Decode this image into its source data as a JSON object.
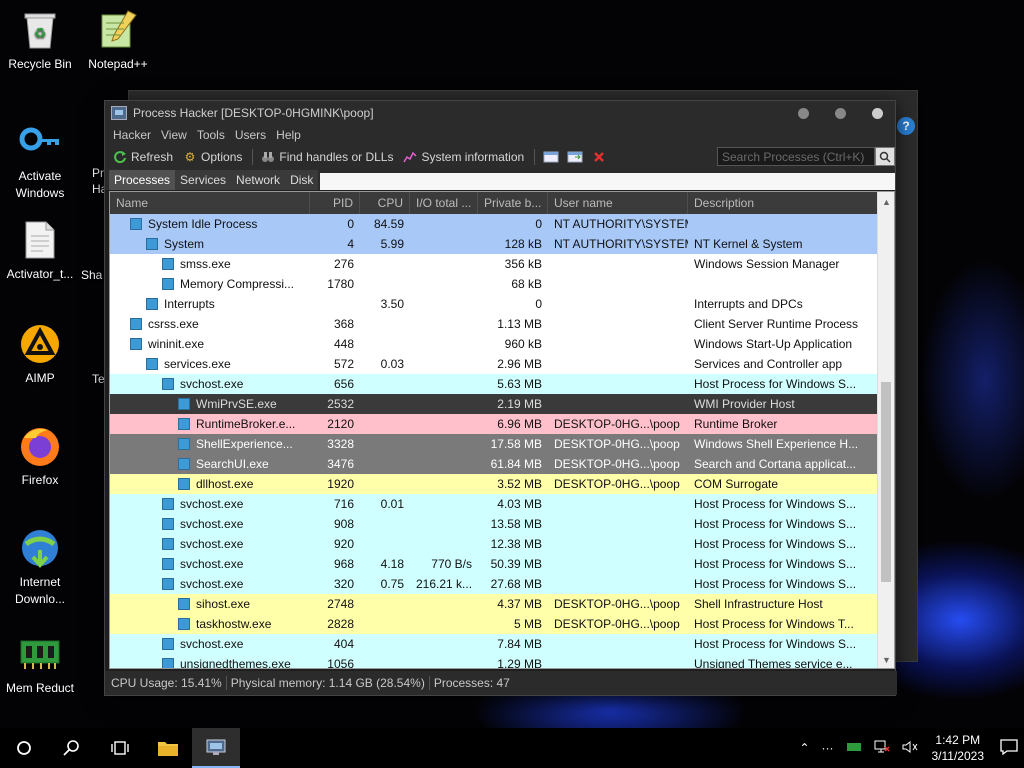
{
  "desktop": {
    "icons": [
      {
        "label": "Recycle Bin",
        "icon": "recycle-bin-icon"
      },
      {
        "label": "Notepad++",
        "icon": "notepadpp-icon"
      },
      {
        "label": "Activate Windows",
        "icon": "key-icon"
      },
      {
        "label": "Activator_t...",
        "icon": "document-icon"
      },
      {
        "label": "AIMP",
        "icon": "aimp-icon"
      },
      {
        "label": "Firefox",
        "icon": "firefox-icon"
      },
      {
        "label": "Internet Downlo...",
        "icon": "idm-icon"
      },
      {
        "label": "Mem Reduct",
        "icon": "memreduct-icon"
      }
    ],
    "partial_labels": [
      "Pr",
      "Ha",
      "Sha",
      "Te"
    ]
  },
  "window": {
    "title": "Process Hacker [DESKTOP-0HGMINK\\poop]",
    "menu": [
      "Hacker",
      "View",
      "Tools",
      "Users",
      "Help"
    ],
    "toolbar": {
      "refresh": "Refresh",
      "options": "Options",
      "find_handles": "Find handles or DLLs",
      "system_info": "System information"
    },
    "search_placeholder": "Search Processes (Ctrl+K)",
    "tabs": [
      "Processes",
      "Services",
      "Network",
      "Disk"
    ],
    "active_tab": "Processes",
    "columns": [
      "Name",
      "PID",
      "CPU",
      "I/O total ...",
      "Private b...",
      "User name",
      "Description"
    ],
    "rows": [
      {
        "name": "System Idle Process",
        "pid": "0",
        "cpu": "84.59",
        "io": "",
        "priv": "0",
        "user": "NT AUTHORITY\\SYSTEM",
        "desc": "",
        "color": "blue",
        "indent": 0,
        "twisty": true
      },
      {
        "name": "System",
        "pid": "4",
        "cpu": "5.99",
        "io": "",
        "priv": "128 kB",
        "user": "NT AUTHORITY\\SYSTEM",
        "desc": "NT Kernel & System",
        "color": "blue",
        "indent": 1,
        "twisty": true
      },
      {
        "name": "smss.exe",
        "pid": "276",
        "cpu": "",
        "io": "",
        "priv": "356 kB",
        "user": "",
        "desc": "Windows Session Manager",
        "color": "white",
        "indent": 2,
        "twisty": false
      },
      {
        "name": "Memory Compressi...",
        "pid": "1780",
        "cpu": "",
        "io": "",
        "priv": "68 kB",
        "user": "",
        "desc": "",
        "color": "white",
        "indent": 2,
        "twisty": false
      },
      {
        "name": "Interrupts",
        "pid": "",
        "cpu": "3.50",
        "io": "",
        "priv": "0",
        "user": "",
        "desc": "Interrupts and DPCs",
        "color": "white",
        "indent": 1,
        "twisty": false
      },
      {
        "name": "csrss.exe",
        "pid": "368",
        "cpu": "",
        "io": "",
        "priv": "1.13 MB",
        "user": "",
        "desc": "Client Server Runtime Process",
        "color": "white",
        "indent": 0,
        "twisty": false
      },
      {
        "name": "wininit.exe",
        "pid": "448",
        "cpu": "",
        "io": "",
        "priv": "960 kB",
        "user": "",
        "desc": "Windows Start-Up Application",
        "color": "white",
        "indent": 0,
        "twisty": true
      },
      {
        "name": "services.exe",
        "pid": "572",
        "cpu": "0.03",
        "io": "",
        "priv": "2.96 MB",
        "user": "",
        "desc": "Services and Controller app",
        "color": "white",
        "indent": 1,
        "twisty": true
      },
      {
        "name": "svchost.exe",
        "pid": "656",
        "cpu": "",
        "io": "",
        "priv": "5.63 MB",
        "user": "",
        "desc": "Host Process for Windows S...",
        "color": "cyan",
        "indent": 2,
        "twisty": true
      },
      {
        "name": "WmiPrvSE.exe",
        "pid": "2532",
        "cpu": "",
        "io": "",
        "priv": "2.19 MB",
        "user": "",
        "desc": "WMI Provider Host",
        "color": "dark",
        "indent": 3,
        "twisty": false
      },
      {
        "name": "RuntimeBroker.e...",
        "pid": "2120",
        "cpu": "",
        "io": "",
        "priv": "6.96 MB",
        "user": "DESKTOP-0HG...\\poop",
        "desc": "Runtime Broker",
        "color": "pink",
        "indent": 3,
        "twisty": false
      },
      {
        "name": "ShellExperience...",
        "pid": "3328",
        "cpu": "",
        "io": "",
        "priv": "17.58 MB",
        "user": "DESKTOP-0HG...\\poop",
        "desc": "Windows Shell Experience H...",
        "color": "gray",
        "indent": 3,
        "twisty": false
      },
      {
        "name": "SearchUI.exe",
        "pid": "3476",
        "cpu": "",
        "io": "",
        "priv": "61.84 MB",
        "user": "DESKTOP-0HG...\\poop",
        "desc": "Search and Cortana applicat...",
        "color": "gray",
        "indent": 3,
        "twisty": false
      },
      {
        "name": "dllhost.exe",
        "pid": "1920",
        "cpu": "",
        "io": "",
        "priv": "3.52 MB",
        "user": "DESKTOP-0HG...\\poop",
        "desc": "COM Surrogate",
        "color": "yellow",
        "indent": 3,
        "twisty": false
      },
      {
        "name": "svchost.exe",
        "pid": "716",
        "cpu": "0.01",
        "io": "",
        "priv": "4.03 MB",
        "user": "",
        "desc": "Host Process for Windows S...",
        "color": "cyan",
        "indent": 2,
        "twisty": false
      },
      {
        "name": "svchost.exe",
        "pid": "908",
        "cpu": "",
        "io": "",
        "priv": "13.58 MB",
        "user": "",
        "desc": "Host Process for Windows S...",
        "color": "cyan",
        "indent": 2,
        "twisty": false
      },
      {
        "name": "svchost.exe",
        "pid": "920",
        "cpu": "",
        "io": "",
        "priv": "12.38 MB",
        "user": "",
        "desc": "Host Process for Windows S...",
        "color": "cyan",
        "indent": 2,
        "twisty": false
      },
      {
        "name": "svchost.exe",
        "pid": "968",
        "cpu": "4.18",
        "io": "770 B/s",
        "priv": "50.39 MB",
        "user": "",
        "desc": "Host Process for Windows S...",
        "color": "cyan",
        "indent": 2,
        "twisty": false
      },
      {
        "name": "svchost.exe",
        "pid": "320",
        "cpu": "0.75",
        "io": "216.21 k...",
        "priv": "27.68 MB",
        "user": "",
        "desc": "Host Process for Windows S...",
        "color": "cyan",
        "indent": 2,
        "twisty": true
      },
      {
        "name": "sihost.exe",
        "pid": "2748",
        "cpu": "",
        "io": "",
        "priv": "4.37 MB",
        "user": "DESKTOP-0HG...\\poop",
        "desc": "Shell Infrastructure Host",
        "color": "yellow",
        "indent": 3,
        "twisty": false
      },
      {
        "name": "taskhostw.exe",
        "pid": "2828",
        "cpu": "",
        "io": "",
        "priv": "5 MB",
        "user": "DESKTOP-0HG...\\poop",
        "desc": "Host Process for Windows T...",
        "color": "yellow",
        "indent": 3,
        "twisty": false
      },
      {
        "name": "svchost.exe",
        "pid": "404",
        "cpu": "",
        "io": "",
        "priv": "7.84 MB",
        "user": "",
        "desc": "Host Process for Windows S...",
        "color": "cyan",
        "indent": 2,
        "twisty": false
      },
      {
        "name": "unsignedthemes.exe",
        "pid": "1056",
        "cpu": "",
        "io": "",
        "priv": "1.29 MB",
        "user": "",
        "desc": "Unsigned Themes service e...",
        "color": "cyan",
        "indent": 2,
        "twisty": false
      }
    ],
    "status": {
      "cpu": "CPU Usage: 15.41%",
      "memory": "Physical memory: 1.14 GB (28.54%)",
      "processes": "Processes: 47"
    }
  },
  "taskbar": {
    "time": "1:42 PM",
    "date": "3/11/2023"
  },
  "colors": {
    "row_blue": "#a8c8f8",
    "row_cyan": "#d0ffff",
    "row_pink": "#ffc0cc",
    "row_gray": "#7a7a7a",
    "row_yellow": "#ffffaa",
    "row_dark": "#3a3a3a"
  }
}
